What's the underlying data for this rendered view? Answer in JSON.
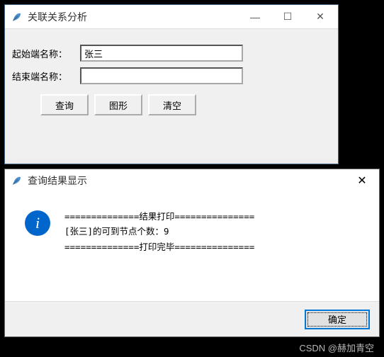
{
  "window": {
    "title": "关联关系分析",
    "minimize": "—",
    "maximize": "☐",
    "close": "✕"
  },
  "form": {
    "start_label": "起始端名称：",
    "start_value": "张三",
    "end_label": "结束端名称：",
    "end_value": ""
  },
  "buttons": {
    "query": "查询",
    "graph": "图形",
    "clear": "清空"
  },
  "dialog": {
    "title": "查询结果显示",
    "close": "✕",
    "info_glyph": "i",
    "line1": "==============结果打印===============",
    "line2": "[张三]的可到节点个数：9",
    "line3": "==============打印完毕===============",
    "ok": "确定"
  },
  "watermark": "CSDN @赫加青空"
}
